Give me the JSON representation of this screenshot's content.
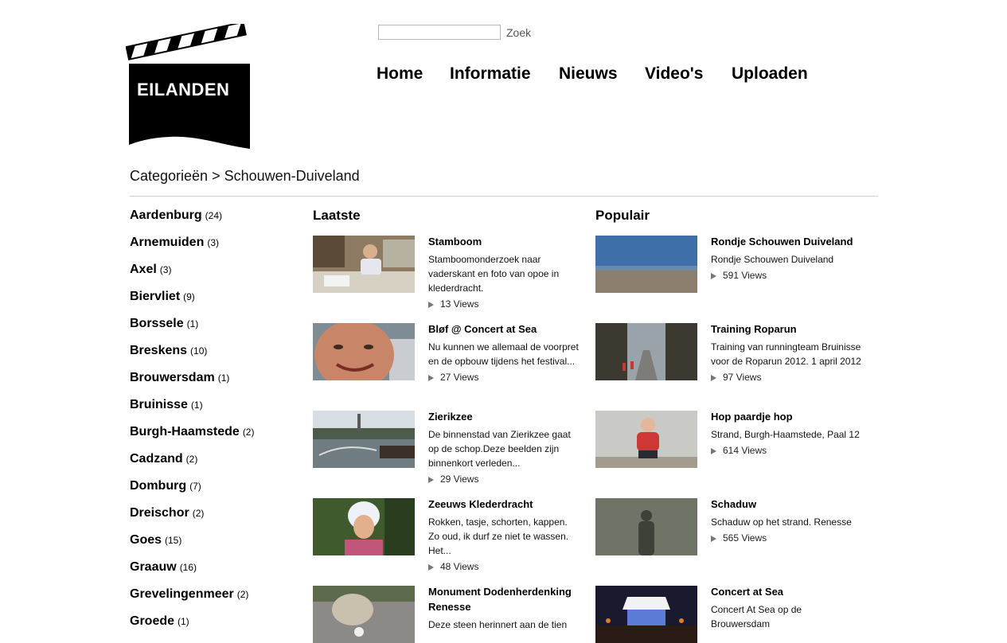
{
  "logo": {
    "text": "EILANDEN"
  },
  "search": {
    "value": "",
    "placeholder": "",
    "button_label": "Zoek"
  },
  "nav": [
    "Home",
    "Informatie",
    "Nieuws",
    "Video's",
    "Uploaden"
  ],
  "breadcrumb": "Categorieën > Schouwen-Duiveland",
  "categories": [
    {
      "name": "Aardenburg",
      "count": "(24)"
    },
    {
      "name": "Arnemuiden",
      "count": "(3)"
    },
    {
      "name": "Axel",
      "count": "(3)"
    },
    {
      "name": "Biervliet",
      "count": "(9)"
    },
    {
      "name": "Borssele",
      "count": "(1)"
    },
    {
      "name": "Breskens",
      "count": "(10)"
    },
    {
      "name": "Brouwersdam",
      "count": "(1)"
    },
    {
      "name": "Bruinisse",
      "count": "(1)"
    },
    {
      "name": "Burgh-Haamstede",
      "count": "(2)"
    },
    {
      "name": "Cadzand",
      "count": "(2)"
    },
    {
      "name": "Domburg",
      "count": "(7)"
    },
    {
      "name": "Dreischor",
      "count": "(2)"
    },
    {
      "name": "Goes",
      "count": "(15)"
    },
    {
      "name": "Graauw",
      "count": "(16)"
    },
    {
      "name": "Grevelingenmeer",
      "count": "(2)"
    },
    {
      "name": "Groede",
      "count": "(1)"
    }
  ],
  "latest": {
    "heading": "Laatste",
    "items": [
      {
        "title": "Stamboom",
        "desc": "Stamboomonderzoek naar vaderskant en foto van opoe in klederdracht.",
        "views": "13 Views",
        "thumb": "man-at-desk"
      },
      {
        "title": "Bløf @ Concert at Sea",
        "desc": "Nu kunnen we allemaal de voorpret en de opbouw tijdens het festival...",
        "views": "27 Views",
        "thumb": "smiling-face"
      },
      {
        "title": "Zierikzee",
        "desc": "De binnenstad van Zierikzee gaat op de schop.Deze beelden zijn binnenkort verleden...",
        "views": "29 Views",
        "thumb": "harbour"
      },
      {
        "title": "Zeeuws Klederdracht",
        "desc": "Rokken, tasje, schorten, kappen. Zo oud, ik durf ze niet te wassen. Het...",
        "views": "48 Views",
        "thumb": "woman-bonnet"
      },
      {
        "title": "Monument Dodenherdenking Renesse",
        "desc": "Deze steen herinnert aan de tien",
        "views": "",
        "thumb": "stone-monument"
      }
    ]
  },
  "popular": {
    "heading": "Populair",
    "items": [
      {
        "title": "Rondje Schouwen Duiveland",
        "desc": "Rondje Schouwen Duiveland",
        "views": "591 Views",
        "thumb": "beach"
      },
      {
        "title": "Training Roparun",
        "desc": "Training van runningteam Bruinisse voor de Roparun 2012. 1 april 2012",
        "views": "97 Views",
        "thumb": "forest-road"
      },
      {
        "title": "Hop paardje hop",
        "desc": "Strand, Burgh-Haamstede, Paal 12",
        "views": "614 Views",
        "thumb": "child-beach"
      },
      {
        "title": "Schaduw",
        "desc": "Schaduw op het strand. Renesse",
        "views": "565 Views",
        "thumb": "shadow"
      },
      {
        "title": "Concert at Sea",
        "desc": "Concert At Sea op de Brouwersdam",
        "views": "",
        "thumb": "stage-night"
      }
    ]
  }
}
